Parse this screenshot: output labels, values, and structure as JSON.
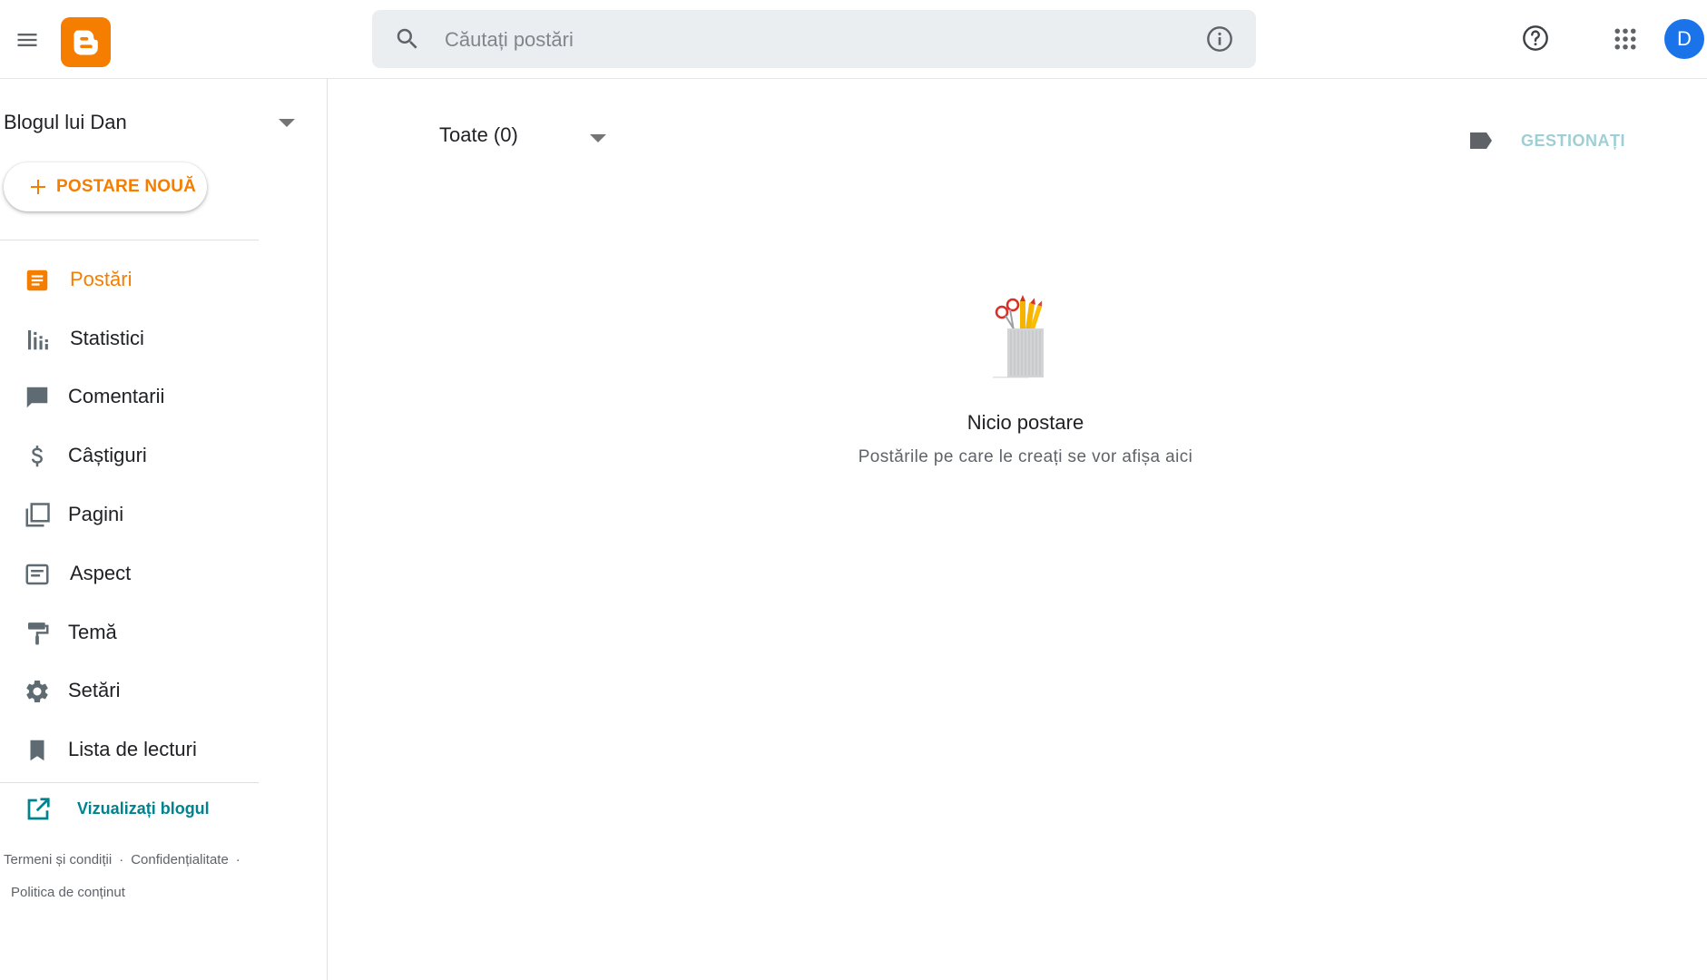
{
  "header": {
    "search_placeholder": "Căutați postări",
    "avatar_initial": "D"
  },
  "sidebar": {
    "blog_name": "Blogul lui Dan",
    "new_post_label": "POSTARE NOUĂ",
    "items": [
      {
        "label": "Postări",
        "icon": "posts-icon",
        "active": true
      },
      {
        "label": "Statistici",
        "icon": "stats-icon"
      },
      {
        "label": "Comentarii",
        "icon": "comments-icon"
      },
      {
        "label": "Câștiguri",
        "icon": "dollar-icon"
      },
      {
        "label": "Pagini",
        "icon": "pages-icon"
      },
      {
        "label": "Aspect",
        "icon": "layout-icon"
      },
      {
        "label": "Temă",
        "icon": "paint-roller-icon"
      },
      {
        "label": "Setări",
        "icon": "gear-icon"
      },
      {
        "label": "Lista de lecturi",
        "icon": "bookmark-icon"
      }
    ],
    "view_blog_label": "Vizualizați blogul",
    "footer": {
      "terms": "Termeni și condiții",
      "privacy": "Confidențialitate",
      "content_policy": "Politica de conținut"
    }
  },
  "main": {
    "filter_label": "Toate (0)",
    "manage_label": "GESTIONAȚI",
    "empty_title": "Nicio postare",
    "empty_subtitle": "Postările pe care le creați se vor afișa aici"
  },
  "colors": {
    "accent": "#f57d00",
    "link": "#00838f",
    "icon": "#5f6b73",
    "avatar": "#1a73e8"
  }
}
